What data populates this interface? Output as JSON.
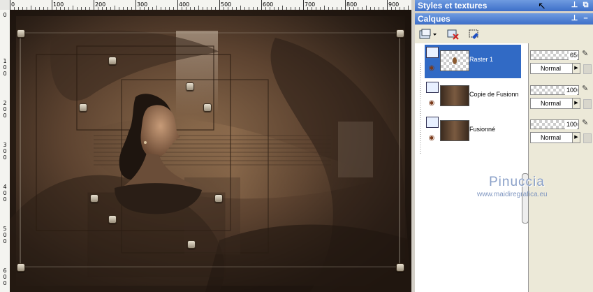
{
  "rulers": {
    "top_labels": [
      "0",
      "100",
      "200",
      "300",
      "400",
      "500",
      "600",
      "700",
      "800",
      "900"
    ],
    "left_labels": [
      "0",
      "1",
      "0",
      "0",
      "2",
      "0",
      "0",
      "3",
      "0",
      "0",
      "4",
      "0",
      "0",
      "5",
      "0",
      "0",
      "6",
      "0",
      "0"
    ]
  },
  "palettes": {
    "styles_title": "Styles et textures",
    "layers_title": "Calques",
    "pin_symbol": "⊥",
    "close_symbol": "–",
    "restore_symbol": "⧉"
  },
  "layers": [
    {
      "name": "Raster 1",
      "opacity": "65",
      "blend": "Normal",
      "selected": true,
      "thumb": "checker"
    },
    {
      "name": "Copie de Fusionn",
      "opacity": "100",
      "blend": "Normal",
      "selected": false,
      "thumb": "image"
    },
    {
      "name": "Fusionné",
      "opacity": "100",
      "blend": "Normal",
      "selected": false,
      "thumb": "image"
    }
  ],
  "watermark": {
    "name": "Pinuccia",
    "url": "www.maidiregrafica.eu"
  },
  "icons": {
    "new_layer": "new-layer-icon",
    "delete_layer": "delete-layer-icon",
    "mask": "mask-icon",
    "eye": "eye-icon",
    "brush": "brush-icon",
    "lock": "lock-icon",
    "cursor": "cursor-icon"
  },
  "colors": {
    "title_bar": "#3d6fc9",
    "selection": "#316ac5"
  }
}
